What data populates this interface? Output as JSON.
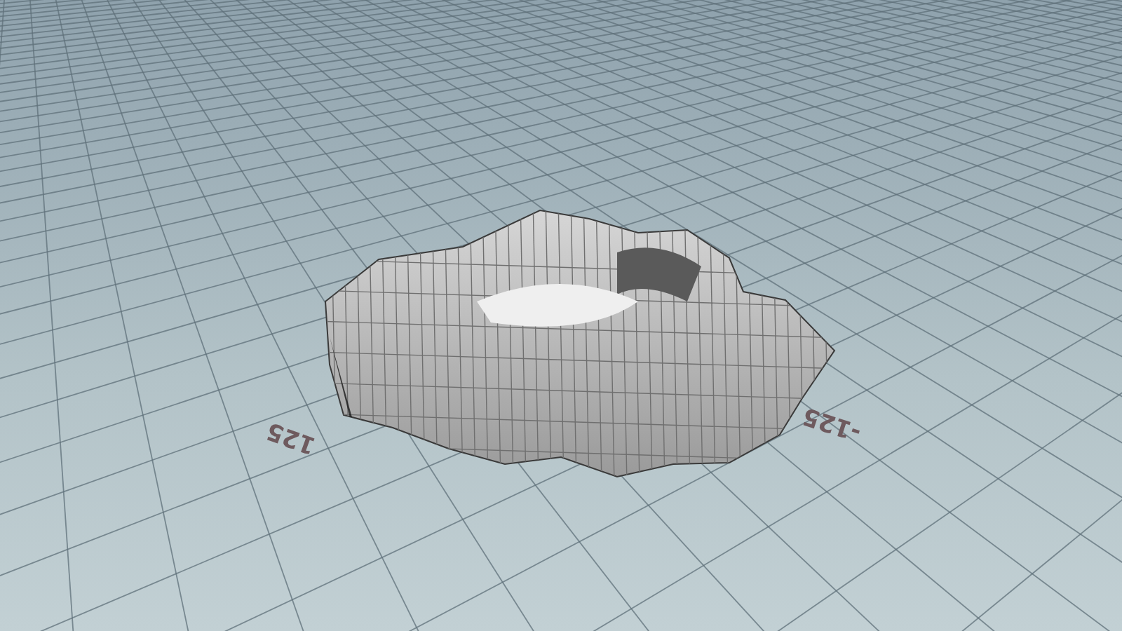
{
  "viewport": {
    "grid_labels": [
      {
        "text": "125"
      },
      {
        "text": "-125"
      }
    ]
  }
}
